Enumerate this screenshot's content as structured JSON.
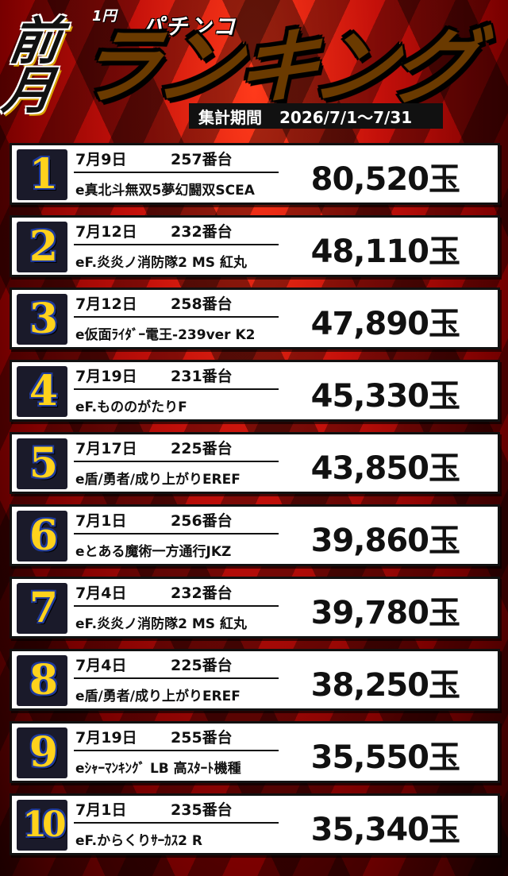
{
  "header": {
    "zengetsu": "前月",
    "ichien": "1円",
    "category": "パチンコ",
    "ranking": "ランキング",
    "period_label": "集計期間",
    "period_value": "2026/7/1～7/31"
  },
  "colors": {
    "accent": "#ffcf2e",
    "background": "#c4100a",
    "badge_number": "#ffd21c",
    "badge_outline": "#1e3a9c"
  },
  "ranking": [
    {
      "rank": "1",
      "date": "7月9日",
      "machine_no": "257番台",
      "model": "e真北斗無双5夢幻闘双SCEA",
      "payout": "80,520玉"
    },
    {
      "rank": "2",
      "date": "7月12日",
      "machine_no": "232番台",
      "model": "eF.炎炎ノ消防隊2 MS 紅丸",
      "payout": "48,110玉"
    },
    {
      "rank": "3",
      "date": "7月12日",
      "machine_no": "258番台",
      "model": "e仮面ﾗｲﾀﾞｰ電王-239ver K2",
      "payout": "47,890玉"
    },
    {
      "rank": "4",
      "date": "7月19日",
      "machine_no": "231番台",
      "model": "eF.もののがたりF",
      "payout": "45,330玉"
    },
    {
      "rank": "5",
      "date": "7月17日",
      "machine_no": "225番台",
      "model": "e盾/勇者/成り上がりEREF",
      "payout": "43,850玉"
    },
    {
      "rank": "6",
      "date": "7月1日",
      "machine_no": "256番台",
      "model": "eとある魔術一方通行JKZ",
      "payout": "39,860玉"
    },
    {
      "rank": "7",
      "date": "7月4日",
      "machine_no": "232番台",
      "model": "eF.炎炎ノ消防隊2 MS 紅丸",
      "payout": "39,780玉"
    },
    {
      "rank": "8",
      "date": "7月4日",
      "machine_no": "225番台",
      "model": "e盾/勇者/成り上がりEREF",
      "payout": "38,250玉"
    },
    {
      "rank": "9",
      "date": "7月19日",
      "machine_no": "255番台",
      "model": "eｼｬｰﾏﾝｷﾝｸﾞ LB 高ｽﾀｰﾄ機種",
      "payout": "35,550玉"
    },
    {
      "rank": "10",
      "date": "7月1日",
      "machine_no": "235番台",
      "model": "eF.からくりｻｰｶｽ2 R",
      "payout": "35,340玉"
    }
  ]
}
